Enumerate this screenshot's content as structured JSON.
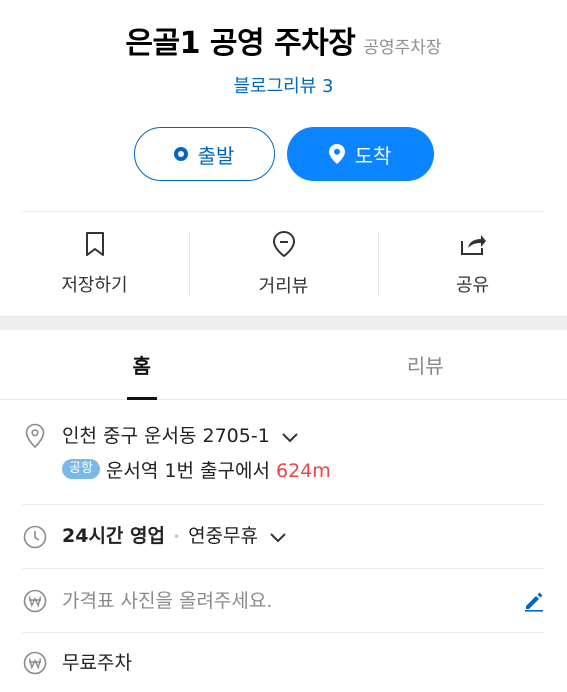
{
  "place": {
    "title": "은골1 공영 주차장",
    "category": "공영주차장",
    "blog_review": "블로그리뷰 3"
  },
  "route": {
    "start_label": "출발",
    "end_label": "도착"
  },
  "actions": {
    "save_label": "저장하기",
    "street_view_label": "거리뷰",
    "share_label": "공유"
  },
  "tabs": {
    "home": "홈",
    "review": "리뷰"
  },
  "info": {
    "address": "인천 중구 운서동 2705-1",
    "transit_badge": "공항",
    "transit_station": "운서역",
    "transit_exit": "1번 출구에서",
    "transit_distance": "624m",
    "hours_status": "24시간 영업",
    "holiday": "연중무휴",
    "price_prompt": "가격표 사진을 올려주세요.",
    "parking": "무료주차"
  },
  "colors": {
    "accent": "#0068c3",
    "primary_button": "#0a84ff",
    "distance": "#ec4646"
  }
}
